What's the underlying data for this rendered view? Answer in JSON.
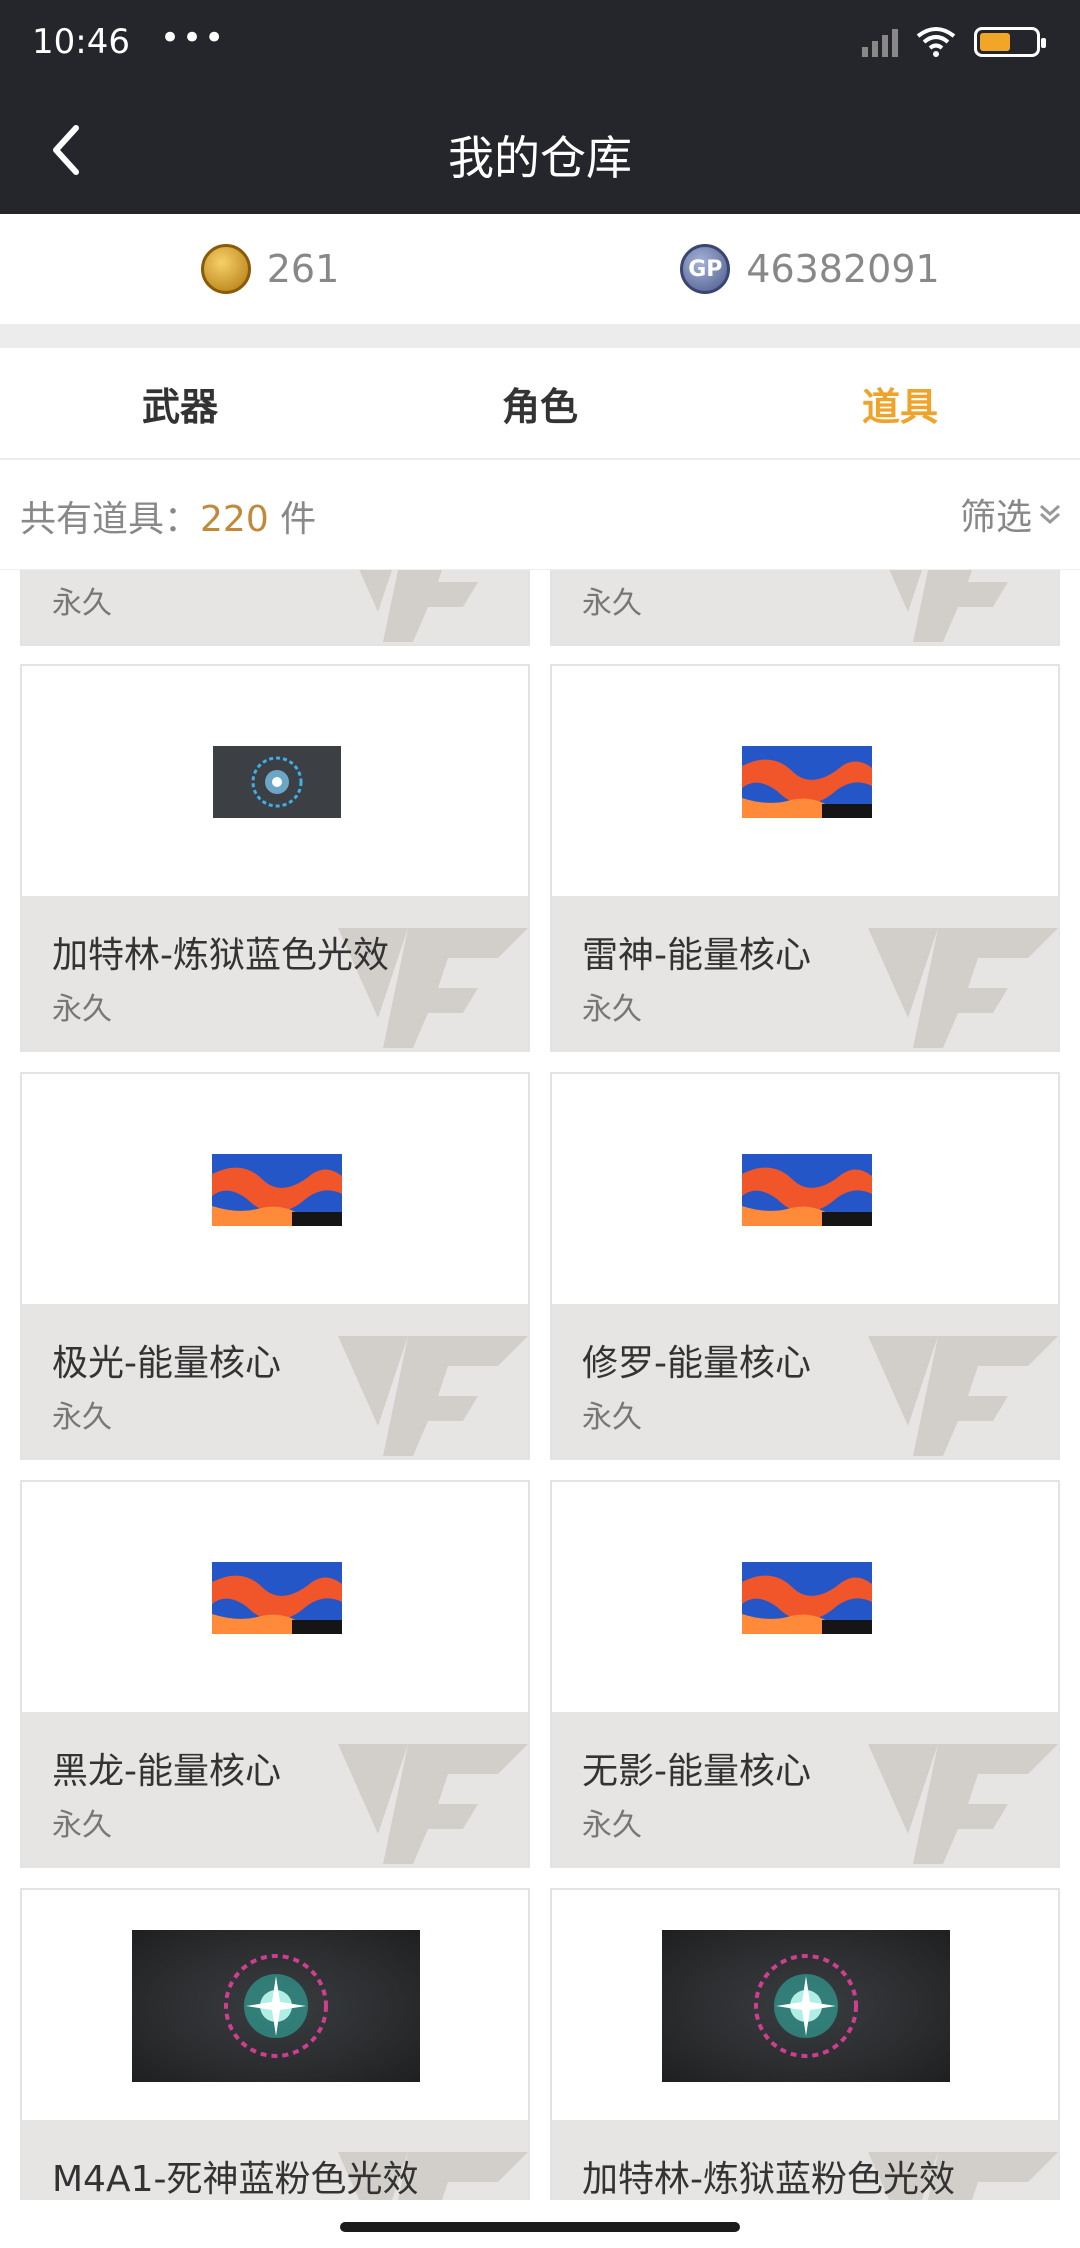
{
  "status_bar": {
    "time": "10:46",
    "dots": "•••"
  },
  "header": {
    "title": "我的仓库"
  },
  "currency": {
    "cf_coins": "261",
    "gp": "46382091",
    "gp_icon_text": "GP"
  },
  "tabs": [
    {
      "label": "武器",
      "active": false
    },
    {
      "label": "角色",
      "active": false
    },
    {
      "label": "道具",
      "active": true
    }
  ],
  "summary": {
    "prefix": "共有道具：",
    "count": "220",
    "suffix": " 件",
    "filter_label": "筛选"
  },
  "items": [
    {
      "name": "",
      "duration": "永久",
      "thumb": "none"
    },
    {
      "name": "",
      "duration": "永久",
      "thumb": "none"
    },
    {
      "name": "加特林-炼狱蓝色光效",
      "duration": "永久",
      "thumb": "blue-glow"
    },
    {
      "name": "雷神-能量核心",
      "duration": "永久",
      "thumb": "flame"
    },
    {
      "name": "极光-能量核心",
      "duration": "永久",
      "thumb": "flame"
    },
    {
      "name": "修罗-能量核心",
      "duration": "永久",
      "thumb": "flame"
    },
    {
      "name": "黑龙-能量核心",
      "duration": "永久",
      "thumb": "flame"
    },
    {
      "name": "无影-能量核心",
      "duration": "永久",
      "thumb": "flame"
    },
    {
      "name": "M4A1-死神蓝粉色光效",
      "duration": "",
      "thumb": "pink-glow"
    },
    {
      "name": "加特林-炼狱蓝粉色光效",
      "duration": "",
      "thumb": "pink-glow"
    }
  ],
  "colors": {
    "header_bg": "#25262b",
    "accent": "#f0a32b",
    "count_color": "#c08a3a"
  }
}
